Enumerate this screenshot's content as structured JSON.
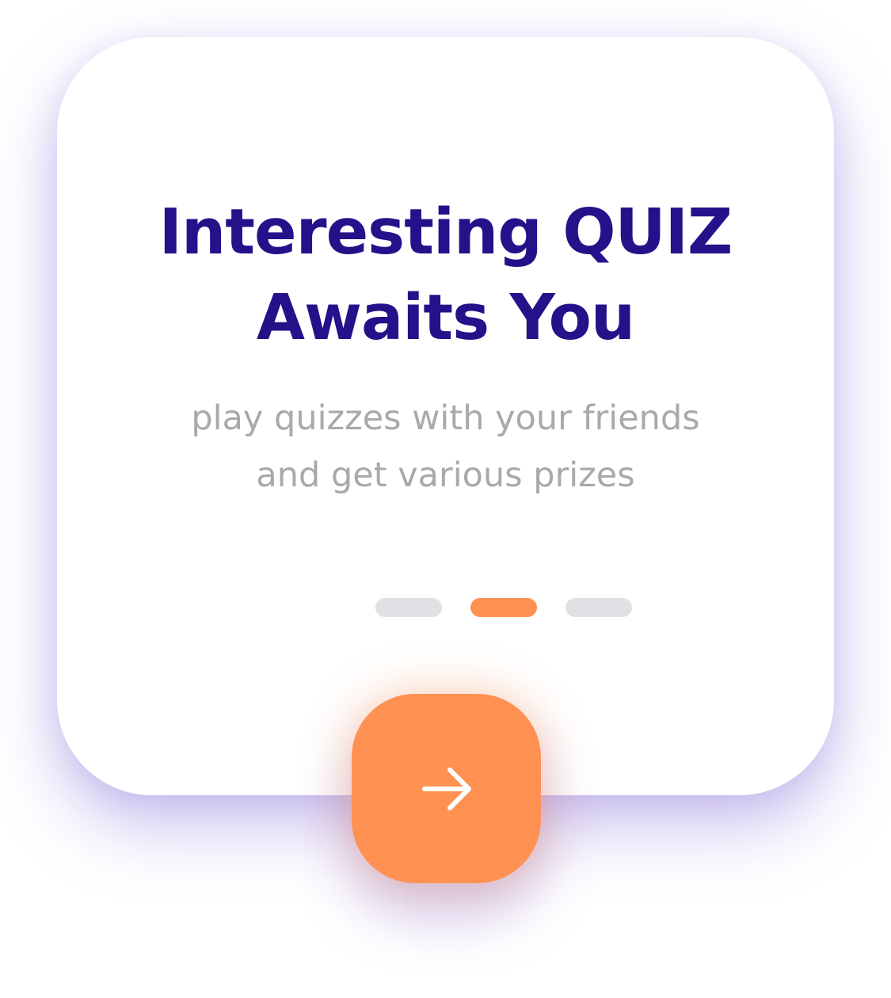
{
  "onboarding": {
    "title_line1": "Interesting QUIZ",
    "title_line2": "Awaits You",
    "subtitle_line1": "play quizzes with your friends",
    "subtitle_line2": "and get various prizes",
    "pager": {
      "total_pages": 3,
      "active_page": 2
    },
    "next_button": {
      "icon": "arrow-right-icon"
    }
  },
  "colors": {
    "title": "#25118a",
    "subtitle": "#a9a9a9",
    "accent": "#ff9153",
    "inactive_dot": "#dfe1e5",
    "card_shadow": "#7e64d7"
  }
}
